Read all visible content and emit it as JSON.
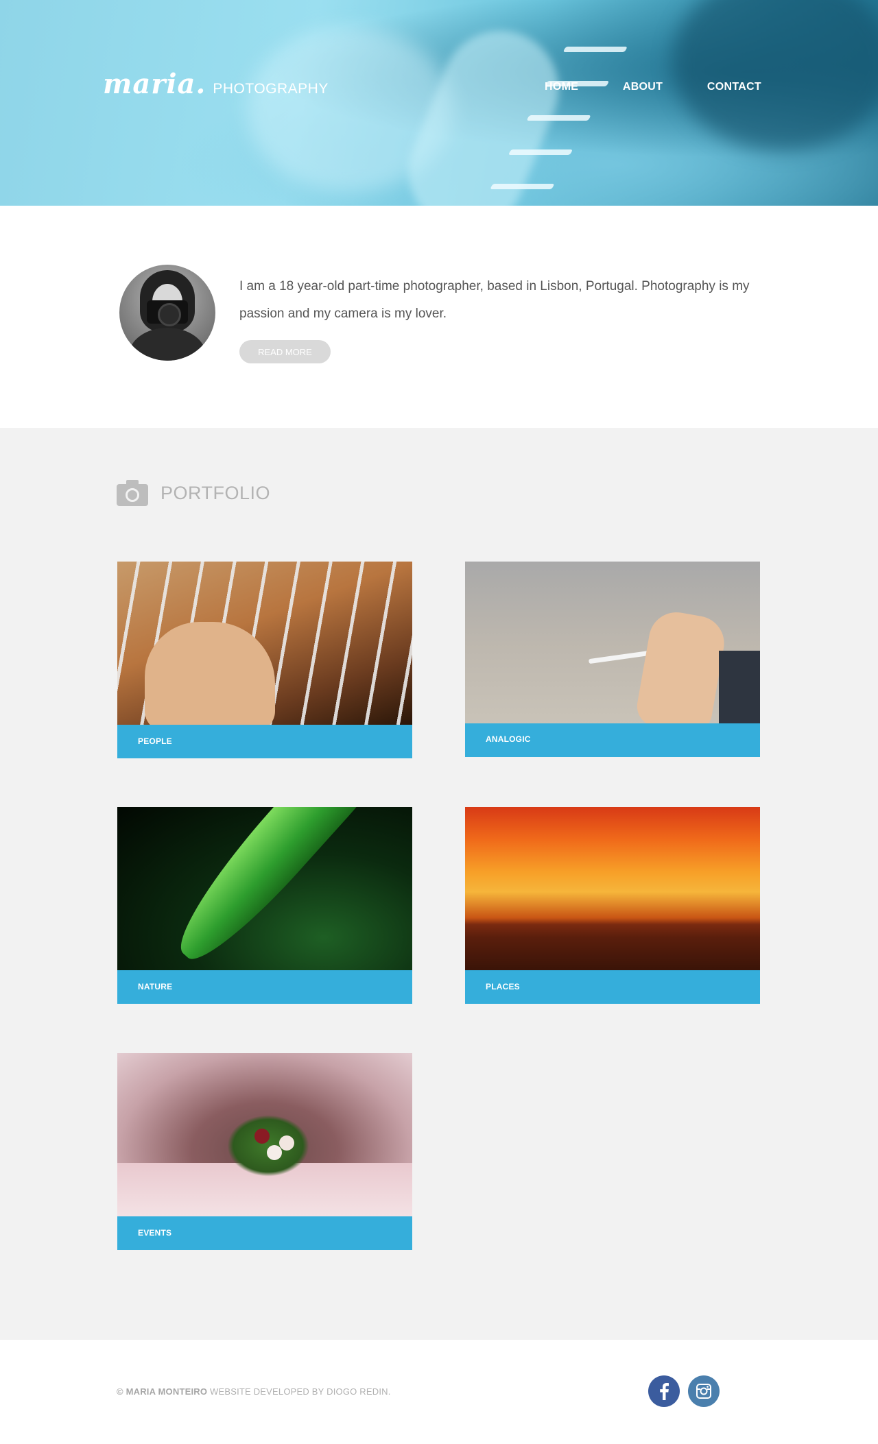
{
  "header": {
    "logo_script": "maria.",
    "logo_sub": "PHOTOGRAPHY",
    "nav": [
      {
        "label": "HOME"
      },
      {
        "label": "ABOUT"
      },
      {
        "label": "CONTACT"
      }
    ]
  },
  "about": {
    "text": "I am a 18 year-old part-time photographer, based in Lisbon, Portugal. Photography is my passion and my camera is my lover.",
    "button_label": "READ MORE"
  },
  "portfolio": {
    "title": "PORTFOLIO",
    "icon": "camera-icon",
    "items": [
      {
        "label": "PEOPLE"
      },
      {
        "label": "ANALOGIC"
      },
      {
        "label": "NATURE"
      },
      {
        "label": "PLACES"
      },
      {
        "label": "EVENTS"
      }
    ]
  },
  "footer": {
    "copyright_name": "© MARIA MONTEIRO",
    "credit": " WEBSITE DEVELOPED BY DIOGO REDIN.",
    "social": [
      {
        "icon": "facebook-icon",
        "color": "#3b5c9e"
      },
      {
        "icon": "instagram-icon",
        "color": "#4a7fad"
      }
    ]
  },
  "colors": {
    "accent": "#35aedb",
    "portfolio_bg": "#f2f2f2",
    "button_bg": "#d9d9d9"
  }
}
